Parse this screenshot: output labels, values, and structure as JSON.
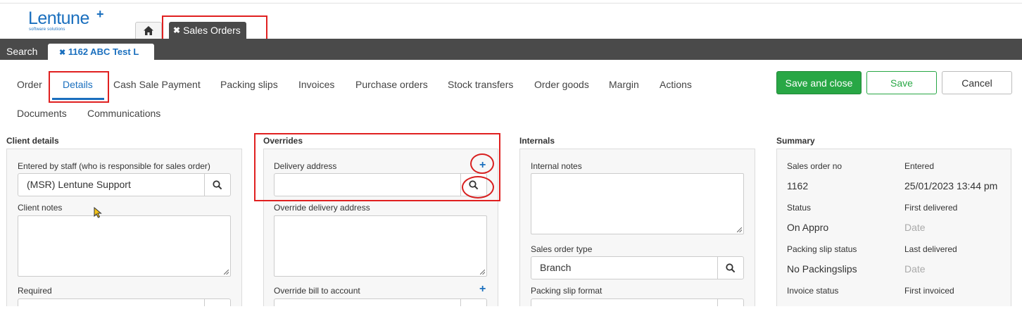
{
  "brand": {
    "name": "Lentune",
    "plus": "+",
    "tagline": "software solutions"
  },
  "top_tabs": {
    "sales_orders": {
      "close": "✖",
      "label": "Sales Orders"
    }
  },
  "bar": {
    "search": "Search",
    "order_tab": {
      "close": "✖",
      "label": "1162 ABC Test L"
    }
  },
  "subtabs": [
    "Order",
    "Details",
    "Cash Sale Payment",
    "Packing slips",
    "Invoices",
    "Purchase orders",
    "Stock transfers",
    "Order goods",
    "Margin",
    "Actions",
    "Documents",
    "Communications"
  ],
  "actions": {
    "save_close": "Save and close",
    "save": "Save",
    "cancel": "Cancel"
  },
  "client": {
    "title": "Client details",
    "entered_by_label": "Entered by staff (who is responsible for sales order)",
    "entered_by_value": "(MSR) Lentune Support",
    "notes_label": "Client notes",
    "required_label": "Required"
  },
  "overrides": {
    "title": "Overrides",
    "delivery_label": "Delivery address",
    "delivery_value": "",
    "override_delivery_label": "Override delivery address",
    "override_bill_label": "Override bill to account",
    "plus": "+"
  },
  "internals": {
    "title": "Internals",
    "notes_label": "Internal notes",
    "type_label": "Sales order type",
    "type_value": "Branch",
    "format_label": "Packing slip format"
  },
  "summary": {
    "title": "Summary",
    "order_no_label": "Sales order no",
    "order_no": "1162",
    "entered_label": "Entered",
    "entered": "25/01/2023 13:44 pm",
    "status_label": "Status",
    "status": "On Appro",
    "first_delivered_label": "First delivered",
    "first_delivered": "Date",
    "packing_status_label": "Packing slip status",
    "packing_status": "No Packingslips",
    "last_delivered_label": "Last delivered",
    "last_delivered": "Date",
    "invoice_status_label": "Invoice status",
    "first_invoiced_label": "First invoiced"
  }
}
